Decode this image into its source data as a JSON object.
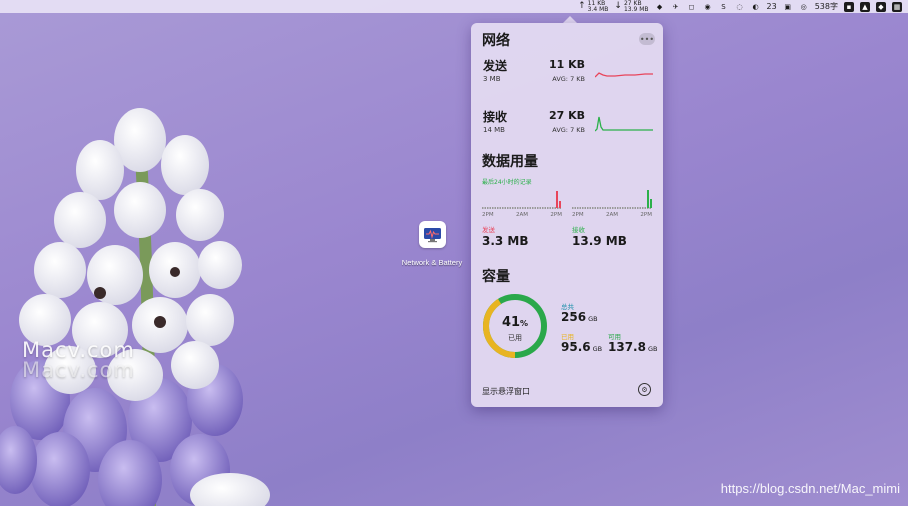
{
  "menubar": {
    "upload": {
      "arrow": "↑",
      "rate": "11 KB",
      "total": "3.4 MB"
    },
    "download": {
      "arrow": "↓",
      "rate": "27 KB",
      "total": "13.9 MB"
    },
    "temperature": "23",
    "word_count": "538字"
  },
  "desktop": {
    "app_icon_label": "Network & Battery",
    "watermark_site": "Macv.com",
    "watermark_url": "https://blog.csdn.net/Mac_mimi"
  },
  "panel": {
    "network": {
      "title": "网络",
      "more_label": "•••",
      "send": {
        "label": "发送",
        "total": "3 MB",
        "rate": "11 KB",
        "avg": "AVG: 7 KB"
      },
      "receive": {
        "label": "接收",
        "total": "14 MB",
        "rate": "27 KB",
        "avg": "AVG: 7 KB"
      }
    },
    "usage": {
      "title": "数据用量",
      "caption": "最后24小时的记录",
      "axis": [
        "2PM",
        "2AM",
        "2PM"
      ],
      "sent_label": "发送",
      "sent_value": "3.3 MB",
      "received_label": "接收",
      "received_value": "13.9 MB"
    },
    "capacity": {
      "title": "容量",
      "percent": "41",
      "percent_unit": "%",
      "used_label": "已用",
      "used_fraction": 0.41,
      "total_label": "总共",
      "total_value": "256",
      "used_value": "95.6",
      "available_label": "可用",
      "available_value": "137.8",
      "unit": "GB"
    },
    "footer": {
      "show_floating": "显示悬浮窗口",
      "settings_icon": "gear-icon"
    }
  },
  "colors": {
    "send": "#e8455b",
    "receive": "#2bb04a",
    "ring_used": "#e8b422",
    "ring_free": "#2aa84a",
    "total_label": "#1a8fa8"
  }
}
